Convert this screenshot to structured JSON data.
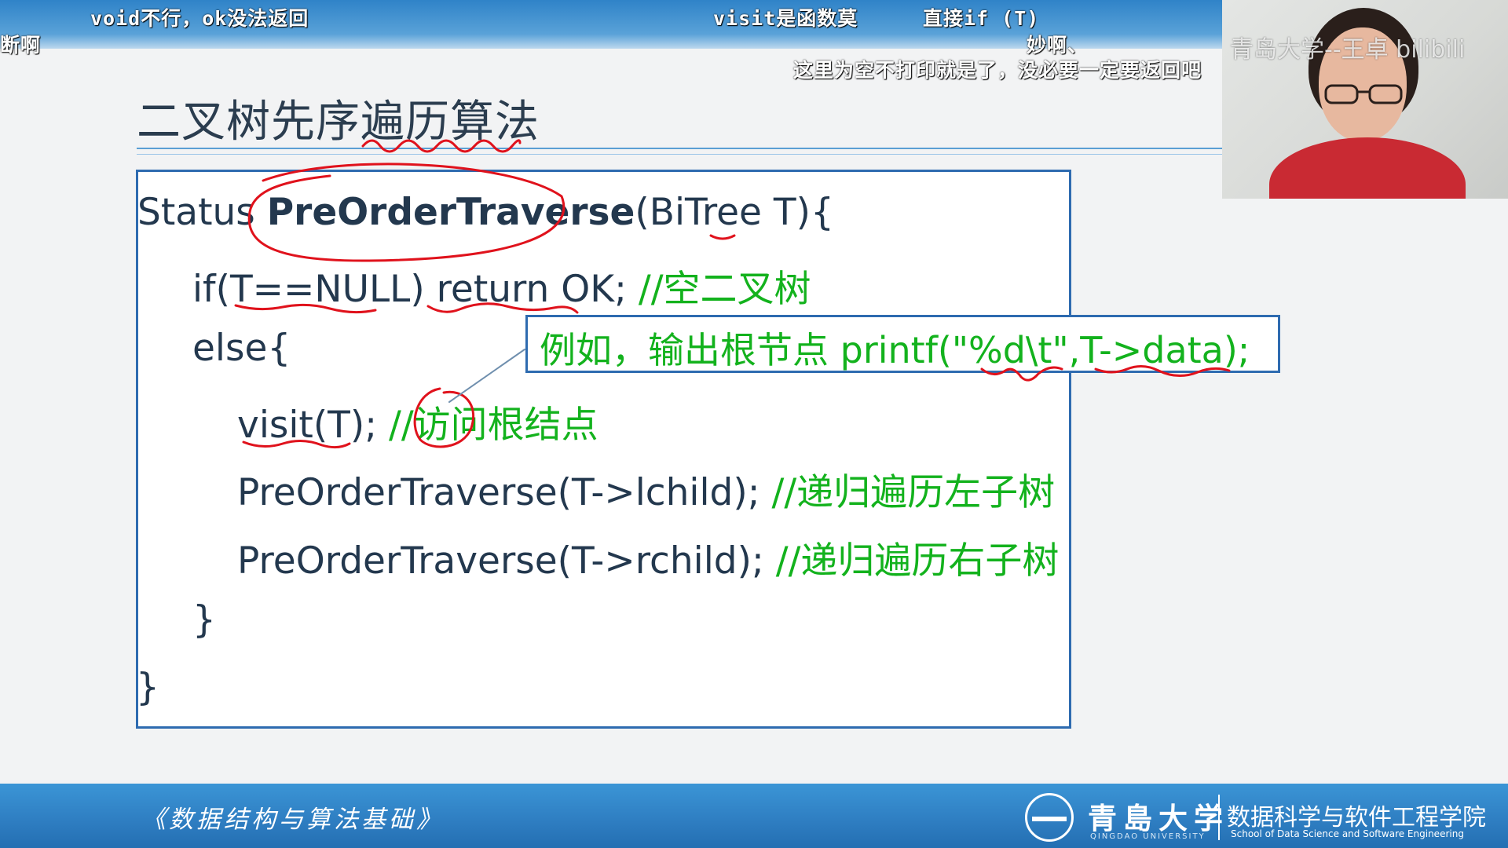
{
  "danmaku": [
    {
      "text": "void不行，ok没法返回"
    },
    {
      "text": "visit是函数莫"
    },
    {
      "text": "直接if (T)"
    },
    {
      "text": "断啊"
    },
    {
      "text": "妙啊、"
    },
    {
      "text": "这里为空不打印就是了，没必要一定要返回吧"
    }
  ],
  "slide": {
    "title": "二叉树先序遍历算法",
    "code": {
      "l1_pre": "Status ",
      "l1_fn": "PreOrderTraverse",
      "l1_post": "(BiTree T){",
      "l2_code": "if(T==NULL) return OK; ",
      "l2_comment": "//空二叉树",
      "l3_code": "else{",
      "l4_code": "visit(T); ",
      "l4_comment": "//访问根结点",
      "l5_code": "PreOrderTraverse(T->lchild); ",
      "l5_comment": "//递归遍历左子树",
      "l6_code": "PreOrderTraverse(T->rchild); ",
      "l6_comment": "//递归遍历右子树",
      "l7_code": "}",
      "l8_code": "}"
    },
    "callout": "例如，输出根节点 printf(\"%d\\t\",T->data);"
  },
  "footer": {
    "course": "《数据结构与算法基础》",
    "university_cn": "青島大学",
    "university_en": "QINGDAO UNIVERSITY",
    "college_cn": "数据科学与软件工程学院",
    "college_en": "School of Data Science and Software Engineering"
  },
  "watermark": "青岛大学--王卓 bilibili"
}
